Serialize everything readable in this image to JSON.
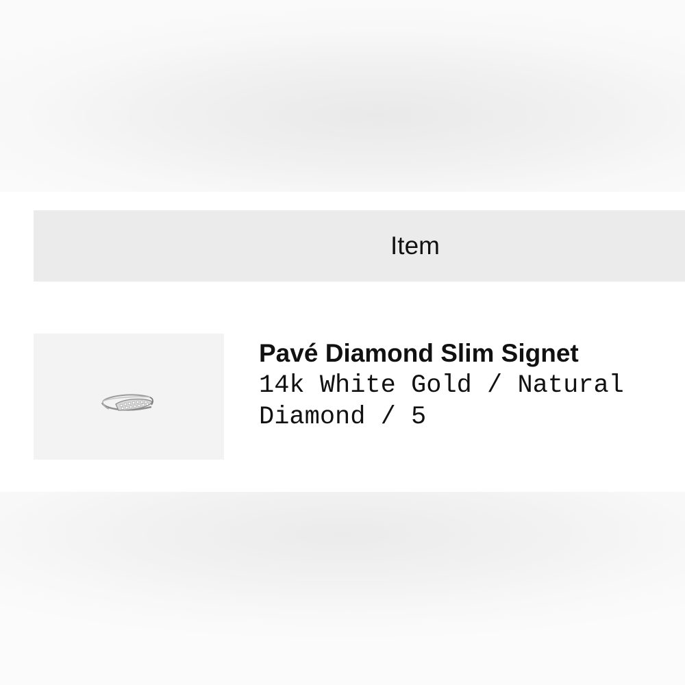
{
  "table": {
    "header": "Item"
  },
  "item": {
    "name": "Pavé Diamond Slim Signet",
    "variant": "14k White Gold / Natural Diamond / 5",
    "thumbnail_icon": "ring-image"
  },
  "colors": {
    "header_background": "#ebebeb",
    "thumbnail_background": "#f3f3f3",
    "text": "#111111"
  }
}
